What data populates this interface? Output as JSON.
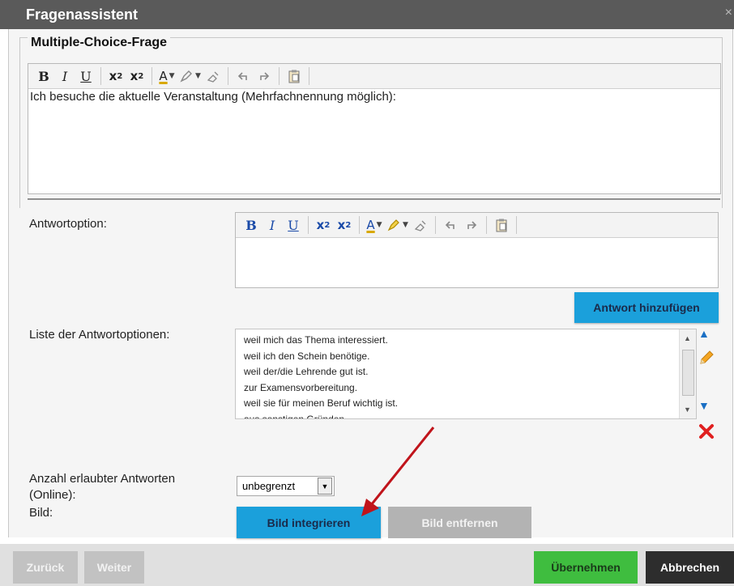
{
  "window": {
    "title": "Fragenassistent",
    "close_glyph": "×"
  },
  "section": {
    "legend": "Multiple-Choice-Frage"
  },
  "toolbar": {
    "bold": "B",
    "italic": "I",
    "underline": "U",
    "subscript": "x",
    "subscript_small": "2",
    "superscript": "x",
    "superscript_small": "2",
    "font_color": "A",
    "dropdown": "▼"
  },
  "question_editor": {
    "text": "Ich besuche die aktuelle Veranstaltung (Mehrfachnennung möglich):"
  },
  "answer_option": {
    "label": "Antwortoption:",
    "text": ""
  },
  "add_answer_button": "Antwort hinzufügen",
  "answer_list": {
    "label": "Liste der Antwortoptionen:",
    "items": [
      "weil mich das Thema interessiert.",
      "weil ich den Schein benötige.",
      "weil der/die Lehrende gut ist.",
      "zur Examensvorbereitung.",
      "weil sie für meinen Beruf wichtig ist.",
      "aus sonstigen Gründen."
    ]
  },
  "allowed_answers": {
    "label_line1": "Anzahl erlaubter Antworten",
    "label_line2": "(Online):",
    "value": "unbegrenzt"
  },
  "image": {
    "label": "Bild:",
    "insert_button": "Bild integrieren",
    "remove_button": "Bild entfernen"
  },
  "footer": {
    "back": "Zurück",
    "next": "Weiter",
    "apply": "Übernehmen",
    "cancel": "Abbrechen"
  },
  "colors": {
    "blue": "#1ba0db",
    "green": "#3fbd3f",
    "titlebar": "#5a5a5a",
    "arrow": "#c0141b"
  }
}
